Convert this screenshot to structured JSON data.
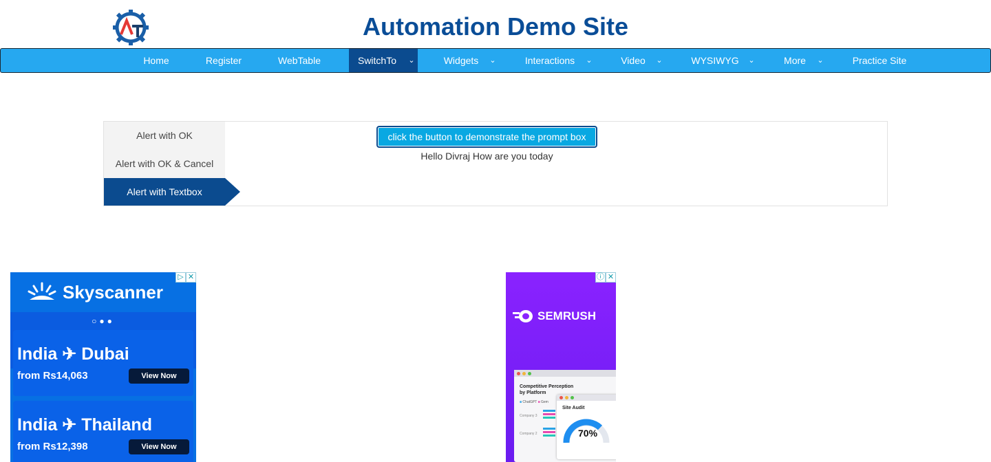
{
  "site": {
    "title": "Automation Demo Site",
    "logo_icon": "gear-icon"
  },
  "nav": {
    "items": [
      {
        "label": "Home",
        "dropdown": false,
        "active": false
      },
      {
        "label": "Register",
        "dropdown": false,
        "active": false
      },
      {
        "label": "WebTable",
        "dropdown": false,
        "active": false
      },
      {
        "label": "SwitchTo",
        "dropdown": true,
        "active": true
      },
      {
        "label": "Widgets",
        "dropdown": true,
        "active": false
      },
      {
        "label": "Interactions",
        "dropdown": true,
        "active": false
      },
      {
        "label": "Video",
        "dropdown": true,
        "active": false
      },
      {
        "label": "WYSIWYG",
        "dropdown": true,
        "active": false
      },
      {
        "label": "More",
        "dropdown": true,
        "active": false
      },
      {
        "label": "Practice Site",
        "dropdown": false,
        "active": false
      }
    ],
    "caret_glyph": "⌄"
  },
  "alerts": {
    "tabs": [
      {
        "label": "Alert with OK",
        "active": false
      },
      {
        "label": "Alert with OK & Cancel",
        "active": false
      },
      {
        "label": "Alert with Textbox",
        "active": true
      }
    ],
    "button_label": "click the button to demonstrate the prompt box",
    "result_text": "Hello Divraj How are you today"
  },
  "ads": {
    "skyscanner": {
      "brand": "Skyscanner",
      "carousel_dots": "○●●",
      "deals": [
        {
          "route_from": "India",
          "route_to": "Dubai",
          "price": "from Rs14,063",
          "cta": "View Now"
        },
        {
          "route_from": "India",
          "route_to": "Thailand",
          "price": "from Rs12,398",
          "cta": "View Now"
        }
      ]
    },
    "semrush": {
      "brand": "SEMRUSH",
      "card_title_1": "Competitive Perception",
      "card_title_2": "by Platform",
      "legend_1": "ChatGPT",
      "legend_2": "Gem",
      "row_1": "Company 3",
      "row_2": "Company 2",
      "audit_title": "Site Audit",
      "audit_percent": "70%"
    },
    "colors": {
      "nav_bg": "#26a8f0",
      "active_bg": "#0b4b8f",
      "title_color": "#0a4d97",
      "sky_bg": "#0770e3",
      "sem_bg": "#8a22ff"
    }
  }
}
